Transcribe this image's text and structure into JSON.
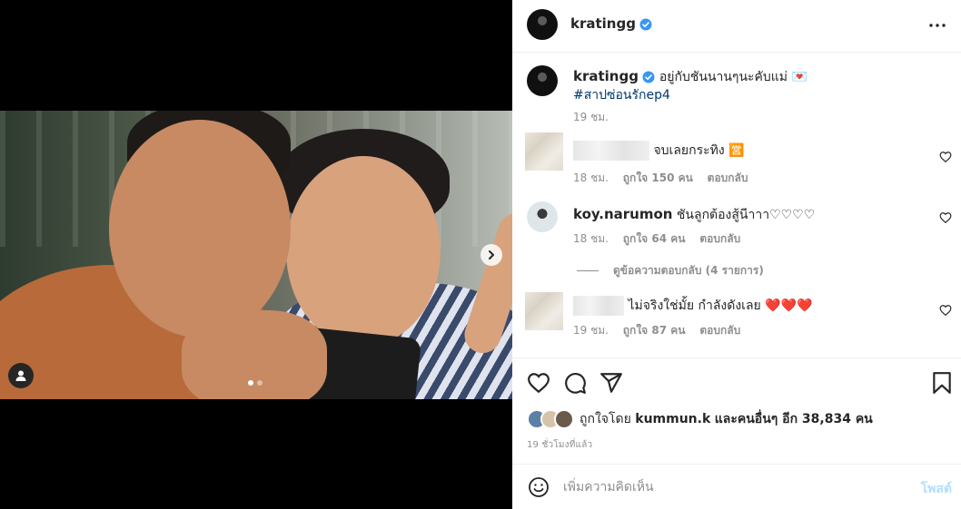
{
  "post": {
    "username": "kratingg",
    "verified": true
  },
  "caption": {
    "username": "kratingg",
    "text": "อยู่กับชันนานๆนะคับแม่ 💌",
    "hashtag": "#สาปซ่อนรักep4",
    "time": "19 ชม."
  },
  "comments": [
    {
      "text": "จบเลยกระทิง 🈺",
      "time": "18 ชม.",
      "likes": "ถูกใจ 150 คน",
      "reply": "ตอบกลับ"
    },
    {
      "username": "koy.narumon",
      "text": "ชันลูกต้องสู้นีาาา♡♡♡♡",
      "time": "18 ชม.",
      "likes": "ถูกใจ 64 คน",
      "reply": "ตอบกลับ",
      "view_replies": "ดูข้อความตอบกลับ (4 รายการ)"
    },
    {
      "text": "ไม่จริงใช่มั้ย กำลังดังเลย",
      "hearts": "❤️❤️❤️",
      "time": "19 ชม.",
      "likes": "ถูกใจ 87 คน",
      "reply": "ตอบกลับ"
    }
  ],
  "likes": {
    "prefix": "ถูกใจโดย",
    "user": "kummun.k",
    "suffix": "และคนอื่นๆ อีก 38,834 คน"
  },
  "timestamp": "19 ชั่วโมงที่แล้ว",
  "add_comment": {
    "placeholder": "เพิ่มความคิดเห็น",
    "post_label": "โพสต์"
  },
  "carousel": {
    "current": 1,
    "total": 2
  },
  "colors": {
    "verified": "#3897f0",
    "link": "#00376b",
    "post_button": "#b2dffc",
    "heart": "#ed4956"
  }
}
